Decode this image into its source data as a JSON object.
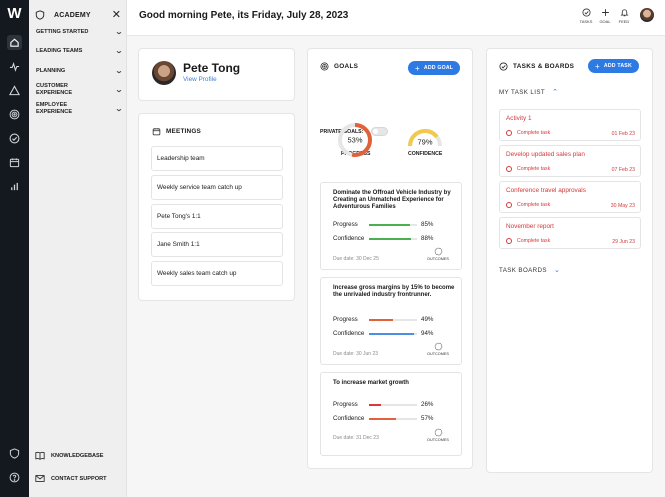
{
  "app": {
    "logo_text": "W"
  },
  "rail": {
    "icons": [
      "home-icon",
      "pulse-icon",
      "warning-icon",
      "target-icon",
      "check-circle-icon",
      "calendar-icon",
      "bar-chart-icon"
    ],
    "bottom_icons": [
      "shield-icon",
      "help-icon"
    ]
  },
  "menu": {
    "title": "ACADEMY",
    "items": [
      {
        "label": "GETTING STARTED"
      },
      {
        "label": "LEADING TEAMS"
      },
      {
        "label": "PLANNING"
      },
      {
        "label": "CUSTOMER EXPERIENCE"
      },
      {
        "label": "EMPLOYEE EXPERIENCE"
      }
    ],
    "footer": [
      {
        "label": "KNOWLEDGEBASE"
      },
      {
        "label": "CONTACT SUPPORT"
      }
    ]
  },
  "header": {
    "greeting": "Good morning Pete, its Friday, July 28, 2023",
    "actions": [
      {
        "label": "TASKS",
        "icon": "check-circle-icon"
      },
      {
        "label": "GOAL",
        "icon": "plus-icon"
      },
      {
        "label": "FEED",
        "icon": "bell-icon"
      }
    ]
  },
  "profile": {
    "name": "Pete Tong",
    "link": "View Profile"
  },
  "meetings": {
    "title": "MEETINGS",
    "items": [
      "Leadership team",
      "Weekly service team catch up",
      "Pete Tong's 1:1",
      "Jane Smith 1:1",
      "Weekly sales team catch up"
    ]
  },
  "goals": {
    "title": "GOALS",
    "add_label": "ADD GOAL",
    "private_label": "PRIVATE GOALS:",
    "progress_label": "PROGRESS",
    "confidence_label": "CONFIDENCE",
    "progress_value": "53%",
    "progress_fraction": 0.53,
    "confidence_value": "79%",
    "confidence_fraction": 0.79,
    "colors": {
      "progress": "#e0623a",
      "confidence": "#f2c94c",
      "green": "#4cb050",
      "blue": "#4a8fe0",
      "red": "#d9363e"
    },
    "progress_row_label": "Progress",
    "confidence_row_label": "Confidence",
    "outcomes_label": "OUTCOMES",
    "items": [
      {
        "title": "Dominate the Offroad Vehicle Industry by Creating an Unmatched Experience for Adventurous Families",
        "progress": "85%",
        "progress_fraction": 0.85,
        "progress_color": "#4cb050",
        "confidence": "88%",
        "confidence_fraction": 0.88,
        "confidence_color": "#4cb050",
        "due": "Due date: 30 Dec 25"
      },
      {
        "title": "Increase gross margins by 15% to become the unrivaled industry frontrunner.",
        "progress": "49%",
        "progress_fraction": 0.49,
        "progress_color": "#e0623a",
        "confidence": "94%",
        "confidence_fraction": 0.94,
        "confidence_color": "#4a8fe0",
        "due": "Due date: 30 Jun 23"
      },
      {
        "title": "To increase market growth",
        "progress": "26%",
        "progress_fraction": 0.26,
        "progress_color": "#d9363e",
        "confidence": "57%",
        "confidence_fraction": 0.57,
        "confidence_color": "#e0623a",
        "due": "Due date: 31 Dec 23"
      }
    ]
  },
  "tasks": {
    "title": "TASKS & BOARDS",
    "add_label": "ADD TASK",
    "list_label": "MY TASK LIST",
    "boards_label": "TASK BOARDS",
    "items": [
      {
        "name": "Activity 1",
        "action": "Complete task",
        "date": "01 Feb 23"
      },
      {
        "name": "Develop updated sales plan",
        "action": "Complete task",
        "date": "07 Feb 23"
      },
      {
        "name": "Conference travel approvals",
        "action": "Complete task",
        "date": "30 May 23"
      },
      {
        "name": "November report",
        "action": "Complete task",
        "date": "29 Jun 23"
      }
    ]
  }
}
